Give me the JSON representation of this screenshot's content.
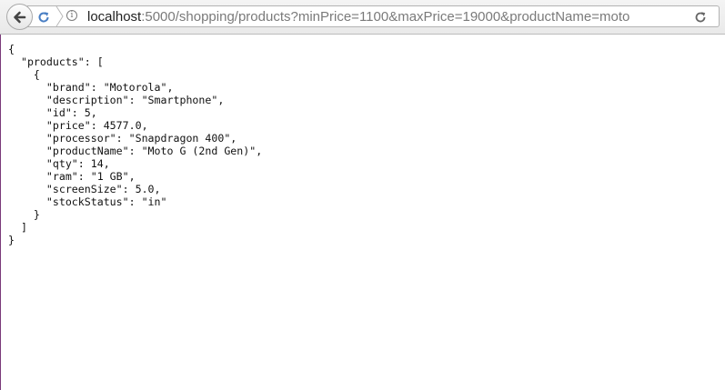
{
  "browser": {
    "url_host": "localhost",
    "url_rest": ":5000/shopping/products?minPrice=1100&maxPrice=19000&productName=moto",
    "icons": {
      "back": "arrow-left-icon",
      "reload_small": "reload-icon",
      "info": "info-icon",
      "reload_right": "reload-icon"
    },
    "info_glyph": "i"
  },
  "json_lines": [
    "{",
    "  \"products\": [",
    "    {",
    "      \"brand\": \"Motorola\",",
    "      \"description\": \"Smartphone\",",
    "      \"id\": 5,",
    "      \"price\": 4577.0,",
    "      \"processor\": \"Snapdragon 400\",",
    "      \"productName\": \"Moto G (2nd Gen)\",",
    "      \"qty\": 14,",
    "      \"ram\": \"1 GB\",",
    "      \"screenSize\": 5.0,",
    "      \"stockStatus\": \"in\"",
    "    }",
    "  ]",
    "}"
  ]
}
